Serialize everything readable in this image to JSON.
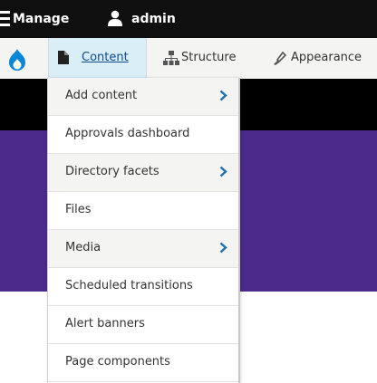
{
  "topbar": {
    "manage_label": "Manage",
    "user_label": "admin"
  },
  "tray": {
    "items": [
      {
        "label": "Content",
        "icon": "file-icon",
        "active": true
      },
      {
        "label": "Structure",
        "icon": "sitemap-icon",
        "active": false
      },
      {
        "label": "Appearance",
        "icon": "paintbrush-icon",
        "active": false
      }
    ]
  },
  "content_menu": {
    "items": [
      {
        "label": "Add content",
        "has_submenu": true
      },
      {
        "label": "Approvals dashboard",
        "has_submenu": false
      },
      {
        "label": "Directory facets",
        "has_submenu": true
      },
      {
        "label": "Files",
        "has_submenu": false
      },
      {
        "label": "Media",
        "has_submenu": true
      },
      {
        "label": "Scheduled transitions",
        "has_submenu": false
      },
      {
        "label": "Alert banners",
        "has_submenu": false
      },
      {
        "label": "Page components",
        "has_submenu": false
      }
    ]
  },
  "colors": {
    "topbar": "#0f0f0f",
    "tray_background": "#f4f4f2",
    "active_tab": "#d9eef6",
    "link": "#0b4b92",
    "drupal_blue": "#0a86d6",
    "chevron": "#1f6fb5",
    "page_purple": "#4b2a8c"
  }
}
